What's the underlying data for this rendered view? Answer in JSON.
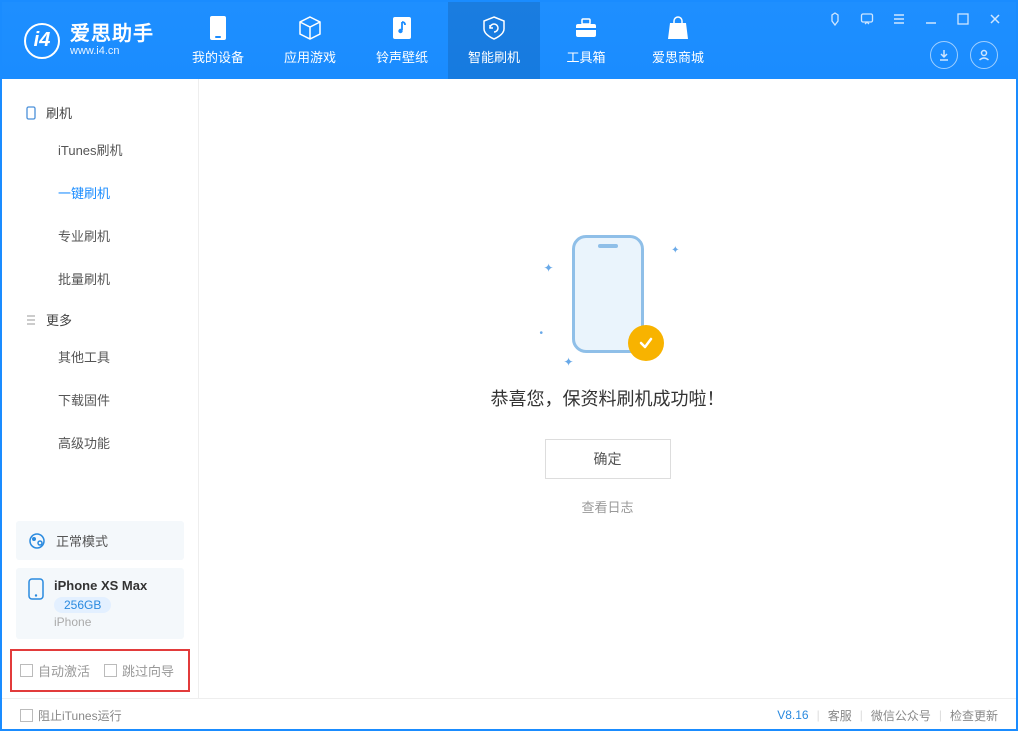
{
  "app": {
    "title": "爱思助手",
    "subtitle": "www.i4.cn"
  },
  "nav": {
    "items": [
      {
        "label": "我的设备"
      },
      {
        "label": "应用游戏"
      },
      {
        "label": "铃声壁纸"
      },
      {
        "label": "智能刷机"
      },
      {
        "label": "工具箱"
      },
      {
        "label": "爱思商城"
      }
    ]
  },
  "sidebar": {
    "group1_label": "刷机",
    "items1": [
      {
        "label": "iTunes刷机"
      },
      {
        "label": "一键刷机"
      },
      {
        "label": "专业刷机"
      },
      {
        "label": "批量刷机"
      }
    ],
    "group2_label": "更多",
    "items2": [
      {
        "label": "其他工具"
      },
      {
        "label": "下载固件"
      },
      {
        "label": "高级功能"
      }
    ],
    "mode_label": "正常模式",
    "device": {
      "name": "iPhone XS Max",
      "storage": "256GB",
      "type": "iPhone"
    },
    "check1": "自动激活",
    "check2": "跳过向导"
  },
  "content": {
    "success_msg": "恭喜您，保资料刷机成功啦！",
    "ok_label": "确定",
    "log_label": "查看日志"
  },
  "footer": {
    "block_itunes": "阻止iTunes运行",
    "version": "V8.16",
    "support": "客服",
    "wechat": "微信公众号",
    "update": "检查更新"
  }
}
